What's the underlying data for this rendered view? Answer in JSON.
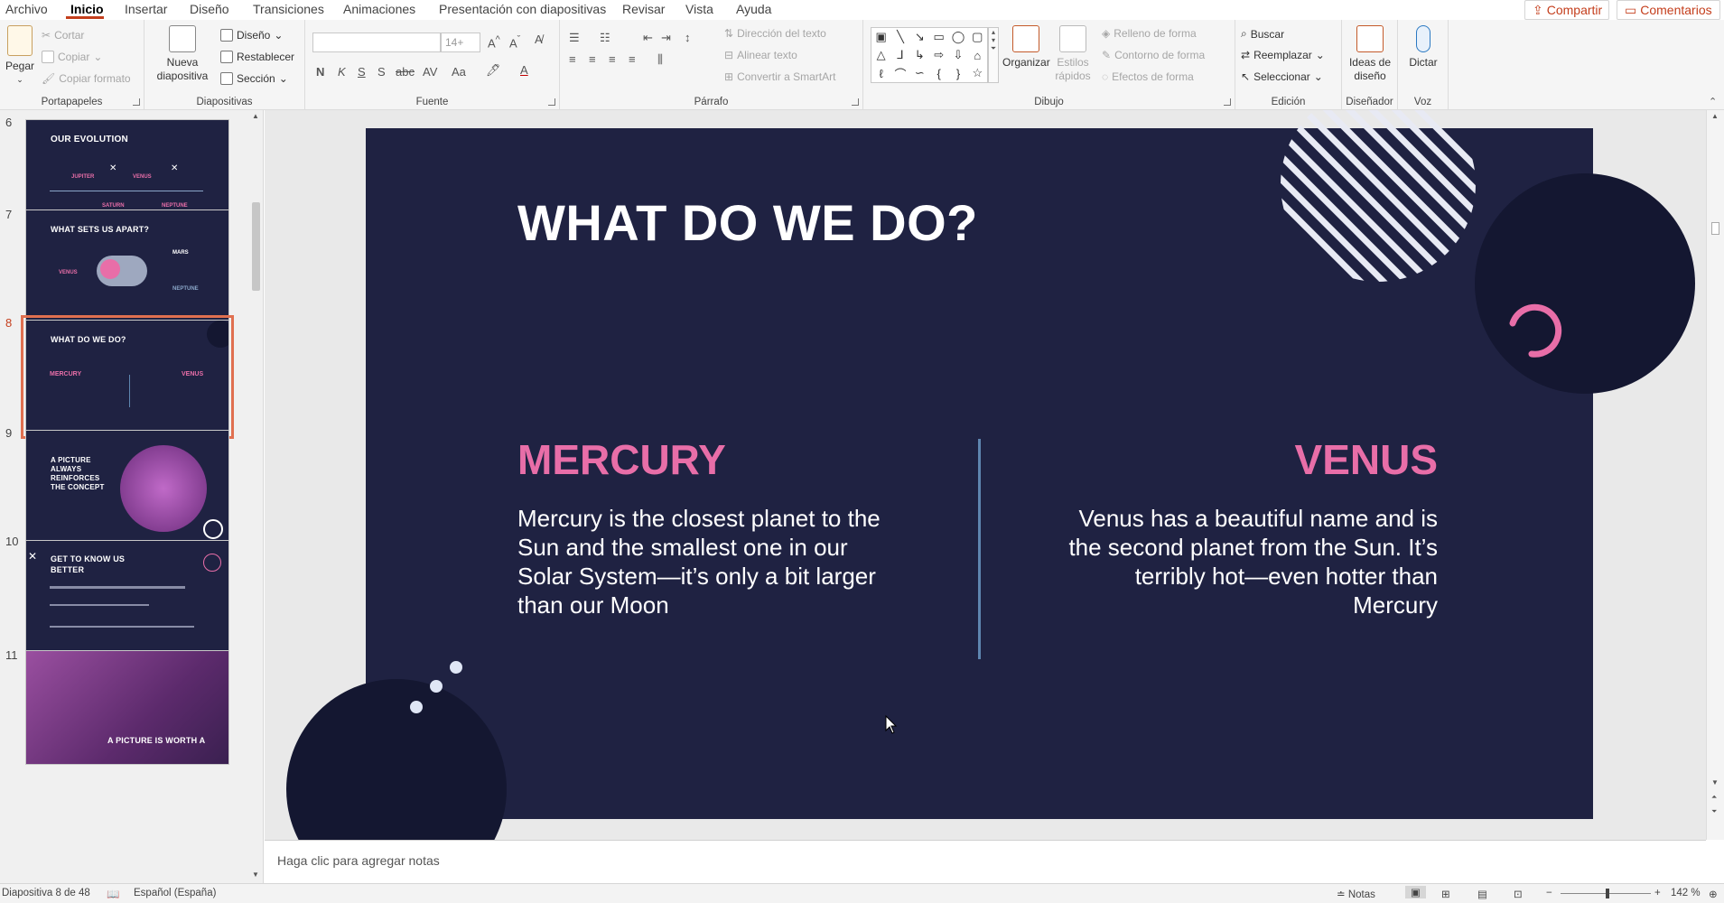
{
  "menu": {
    "items": [
      "Archivo",
      "Inicio",
      "Insertar",
      "Diseño",
      "Transiciones",
      "Animaciones",
      "Presentación con diapositivas",
      "Revisar",
      "Vista",
      "Ayuda"
    ],
    "share": "Compartir",
    "comments": "Comentarios"
  },
  "ribbon": {
    "portapapeles": {
      "paste": "Pegar",
      "cut": "Cortar",
      "copy": "Copiar",
      "format_painter": "Copiar formato",
      "label": "Portapapeles"
    },
    "diapositivas": {
      "new_slide": "Nueva diapositiva",
      "layout": "Diseño",
      "reset": "Restablecer",
      "section": "Sección",
      "label": "Diapositivas"
    },
    "fuente": {
      "font_name": "",
      "font_size": "14+",
      "label": "Fuente"
    },
    "parrafo": {
      "text_direction": "Dirección del texto",
      "align_text": "Alinear texto",
      "convert_smartart": "Convertir a SmartArt",
      "label": "Párrafo"
    },
    "dibujo": {
      "arrange": "Organizar",
      "quick_styles": "Estilos rápidos",
      "shape_fill": "Relleno de forma",
      "shape_outline": "Contorno de forma",
      "shape_effects": "Efectos de forma",
      "label": "Dibujo"
    },
    "edicion": {
      "find": "Buscar",
      "replace": "Reemplazar",
      "select": "Seleccionar",
      "label": "Edición"
    },
    "disenador": {
      "design_ideas": "Ideas de diseño",
      "label": "Diseñador"
    },
    "voz": {
      "dictate": "Dictar",
      "label": "Voz"
    }
  },
  "thumbnails": [
    {
      "num": "6",
      "title": "OUR EVOLUTION",
      "labels": [
        "JUPITER",
        "VENUS",
        "SATURN",
        "NEPTUNE"
      ]
    },
    {
      "num": "7",
      "title": "WHAT SETS US APART?",
      "labels": [
        "VENUS",
        "MARS",
        "NEPTUNE"
      ]
    },
    {
      "num": "8",
      "title": "WHAT DO WE DO?",
      "labels": [
        "MERCURY",
        "VENUS"
      ]
    },
    {
      "num": "9",
      "title": "A PICTURE ALWAYS REINFORCES THE CONCEPT",
      "labels": []
    },
    {
      "num": "10",
      "title": "GET TO KNOW US BETTER",
      "labels": []
    },
    {
      "num": "11",
      "title": "A PICTURE IS WORTH A",
      "labels": []
    }
  ],
  "slide": {
    "title": "WHAT DO WE DO?",
    "left_heading": "MERCURY",
    "left_body": "Mercury is the closest planet to the Sun and the smallest one in our Solar System—it’s only a bit larger than our Moon",
    "right_heading": "VENUS",
    "right_body": "Venus has a beautiful name and is the second planet from the Sun. It’s terribly hot—even hotter than Mercury"
  },
  "notes_placeholder": "Haga clic para agregar notas",
  "status": {
    "slide_counter": "Diapositiva 8 de 48",
    "language": "Español (España)",
    "notes": "Notas",
    "zoom": "142 %"
  },
  "colors": {
    "slide_bg": "#1f2242",
    "accent_pink": "#e86ea8",
    "divider_blue": "#5e86b0",
    "office_orange": "#c43e1c"
  }
}
